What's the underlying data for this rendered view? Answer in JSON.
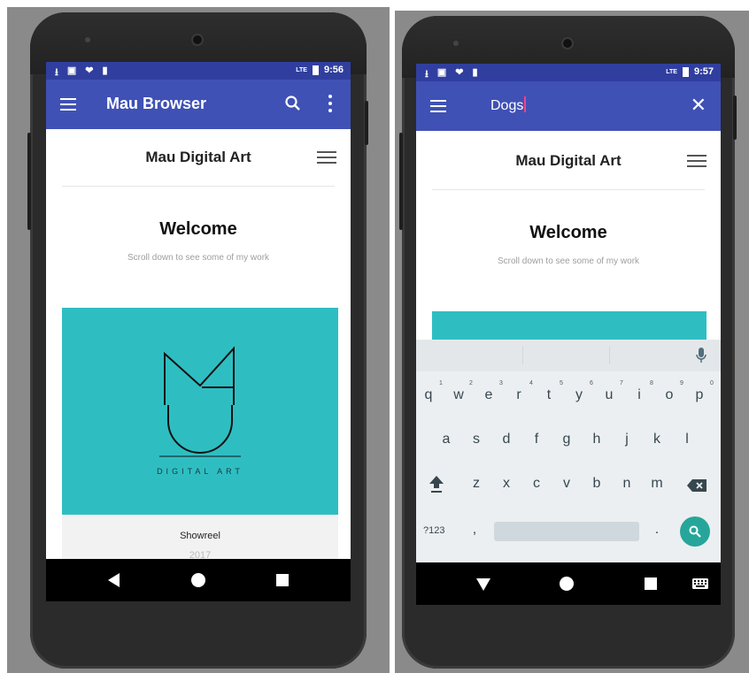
{
  "left_phone": {
    "status": {
      "icons": [
        "⭳",
        "▣",
        "❤",
        "▮"
      ],
      "time": "9:56",
      "signal": "LTE"
    },
    "appbar": {
      "title": "Mau Browser"
    },
    "web": {
      "site_title": "Mau Digital Art",
      "welcome": "Welcome",
      "subtitle": "Scroll down to see some of my work",
      "logo_text": "DIGITAL ART",
      "card_title": "Showreel",
      "card_year": "2017"
    }
  },
  "right_phone": {
    "status": {
      "icons": [
        "⭳",
        "▣",
        "❤",
        "▮"
      ],
      "time": "9:57",
      "signal": "LTE"
    },
    "appbar": {
      "query": "Dogs"
    },
    "web": {
      "site_title": "Mau Digital Art",
      "welcome": "Welcome",
      "subtitle": "Scroll down to see some of my work"
    },
    "keyboard": {
      "row1": [
        "q",
        "w",
        "e",
        "r",
        "t",
        "y",
        "u",
        "i",
        "o",
        "p"
      ],
      "row1_hints": [
        "1",
        "2",
        "3",
        "4",
        "5",
        "6",
        "7",
        "8",
        "9",
        "0"
      ],
      "row2": [
        "a",
        "s",
        "d",
        "f",
        "g",
        "h",
        "j",
        "k",
        "l"
      ],
      "row3": [
        "z",
        "x",
        "c",
        "v",
        "b",
        "n",
        "m"
      ],
      "symbols_label": "?123",
      "comma": ",",
      "period": "."
    }
  },
  "colors": {
    "primary": "#3f51b5",
    "primary_dark": "#303f9f",
    "teal": "#2ebec2",
    "accent": "#26a69a"
  }
}
